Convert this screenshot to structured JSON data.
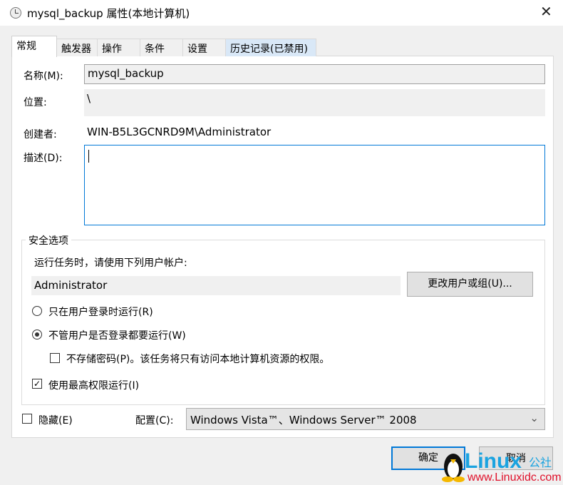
{
  "window": {
    "title": "mysql_backup 属性(本地计算机)",
    "close": "✕"
  },
  "tabs": [
    "常规",
    "触发器",
    "操作",
    "条件",
    "设置",
    "历史记录(已禁用)"
  ],
  "general": {
    "name_label": "名称(M):",
    "name_value": "mysql_backup",
    "location_label": "位置:",
    "location_value": "\\",
    "author_label": "创建者:",
    "author_value": "WIN-B5L3GCNRD9M\\Administrator",
    "desc_label": "描述(D):",
    "desc_value": ""
  },
  "security": {
    "title": "安全选项",
    "run_as_label": "运行任务时，请使用下列用户帐户:",
    "user": "Administrator",
    "change_user_button": "更改用户或组(U)...",
    "radio_logged_on": "只在用户登录时运行(R)",
    "radio_whether": "不管用户是否登录都要运行(W)",
    "no_store_password": "不存储密码(P)。该任务将只有访问本地计算机资源的权限。",
    "highest_privileges": "使用最高权限运行(I)",
    "selected_radio": "whether",
    "no_store_checked": false,
    "highest_checked": true
  },
  "hidden_label": "隐藏(E)",
  "hidden_checked": false,
  "configure_label": "配置(C):",
  "configure_value": "Windows Vista™、Windows Server™ 2008",
  "ok_button": "确定",
  "cancel_button": "取消",
  "watermark": {
    "brand": "Linux公社",
    "url": "www.Linuxidc.com"
  }
}
